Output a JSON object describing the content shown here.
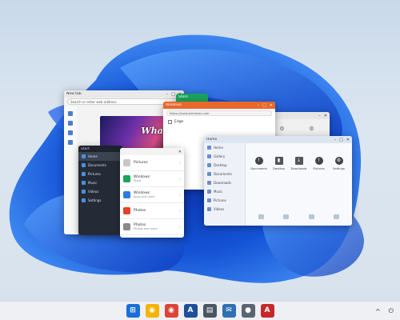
{
  "windows": {
    "edge": {
      "title": "New tab",
      "address": "Search or enter web address",
      "hero_text": "Whatte"
    },
    "start": {
      "title": "Start",
      "items": [
        "Home",
        "Documents",
        "Pictures",
        "Music",
        "Videos",
        "Settings"
      ]
    },
    "store": {
      "rows": [
        {
          "label": "Pictures",
          "sub": ""
        },
        {
          "label": "Windows",
          "sub": "Store"
        },
        {
          "label": "Windows",
          "sub": "Apps and more"
        },
        {
          "label": "Photos",
          "sub": ""
        },
        {
          "label": "Photos",
          "sub": "Photos and more"
        }
      ]
    },
    "green": {
      "title": "Store"
    },
    "browser2": {
      "title": "Windows",
      "address": "https://www.windows.com",
      "item": "Edge"
    },
    "explorer": {
      "title": "Home",
      "sidebar": [
        "Home",
        "Gallery",
        "Desktop",
        "Documents",
        "Downloads",
        "Music",
        "Pictures",
        "Videos"
      ],
      "tiles": [
        "Documents",
        "Desktop",
        "Downloads",
        "Pictures",
        "Settings"
      ]
    }
  },
  "taskbar": {
    "apps": [
      {
        "name": "start",
        "glyph": "⊞",
        "color": "#1a6fd6"
      },
      {
        "name": "chrome",
        "glyph": "◉",
        "color": "#f4b400"
      },
      {
        "name": "chrome-2",
        "glyph": "◉",
        "color": "#db4437"
      },
      {
        "name": "app-blue",
        "glyph": "A",
        "color": "#1f4e9c"
      },
      {
        "name": "app-dark",
        "glyph": "▤",
        "color": "#4b5563"
      },
      {
        "name": "mail",
        "glyph": "✉",
        "color": "#2f6fb3"
      },
      {
        "name": "app-circle",
        "glyph": "●",
        "color": "#5b6472"
      },
      {
        "name": "acrobat",
        "glyph": "A",
        "color": "#c62828"
      }
    ],
    "tray_chevron": "^",
    "tray_power": "⏻"
  },
  "colors": {
    "wallpaper_blue": "#1f5fe0",
    "accent": "#0063d1"
  }
}
